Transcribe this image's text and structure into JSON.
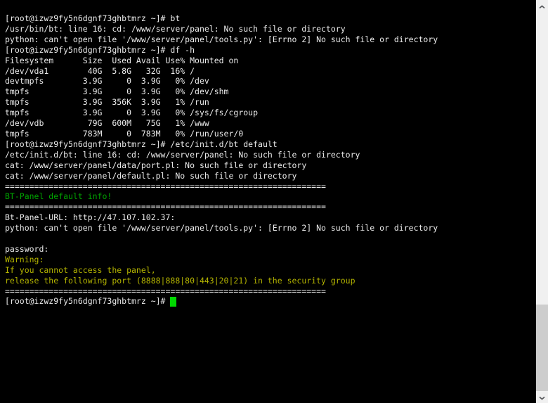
{
  "terminal": {
    "colors": {
      "background": "#000000",
      "foreground": "#ebebeb",
      "green": "#00a400",
      "yellow": "#b4b400",
      "cursor_green": "#00d800"
    },
    "lines": [
      {
        "text": "[root@izwz9fy5n6dgnf73ghbtmrz ~]# bt",
        "color": "default"
      },
      {
        "text": "/usr/bin/bt: line 16: cd: /www/server/panel: No such file or directory",
        "color": "default"
      },
      {
        "text": "python: can't open file '/www/server/panel/tools.py': [Errno 2] No such file or directory",
        "color": "default"
      },
      {
        "text": "[root@izwz9fy5n6dgnf73ghbtmrz ~]# df -h",
        "color": "default"
      },
      {
        "text": "Filesystem      Size  Used Avail Use% Mounted on",
        "color": "default"
      },
      {
        "text": "/dev/vda1        40G  5.8G   32G  16% /",
        "color": "default"
      },
      {
        "text": "devtmpfs        3.9G     0  3.9G   0% /dev",
        "color": "default"
      },
      {
        "text": "tmpfs           3.9G     0  3.9G   0% /dev/shm",
        "color": "default"
      },
      {
        "text": "tmpfs           3.9G  356K  3.9G   1% /run",
        "color": "default"
      },
      {
        "text": "tmpfs           3.9G     0  3.9G   0% /sys/fs/cgroup",
        "color": "default"
      },
      {
        "text": "/dev/vdb         79G  600M   75G   1% /www",
        "color": "default"
      },
      {
        "text": "tmpfs           783M     0  783M   0% /run/user/0",
        "color": "default"
      },
      {
        "text": "[root@izwz9fy5n6dgnf73ghbtmrz ~]# /etc/init.d/bt default",
        "color": "default"
      },
      {
        "text": "/etc/init.d/bt: line 16: cd: /www/server/panel: No such file or directory",
        "color": "default"
      },
      {
        "text": "cat: /www/server/panel/data/port.pl: No such file or directory",
        "color": "default"
      },
      {
        "text": "cat: /www/server/panel/default.pl: No such file or directory",
        "color": "default"
      },
      {
        "text": "==================================================================",
        "color": "default"
      },
      {
        "text": "BT-Panel default info!",
        "color": "green"
      },
      {
        "text": "==================================================================",
        "color": "default"
      },
      {
        "text": "Bt-Panel-URL: http://47.107.102.37:",
        "color": "default"
      },
      {
        "text": "python: can't open file '/www/server/panel/tools.py': [Errno 2] No such file or directory",
        "color": "default"
      },
      {
        "text": "",
        "color": "default"
      },
      {
        "text": "password:",
        "color": "default"
      },
      {
        "text": "Warning:",
        "color": "yellow"
      },
      {
        "text": "If you cannot access the panel,",
        "color": "yellow"
      },
      {
        "text": "release the following port (8888|888|80|443|20|21) in the security group",
        "color": "yellow"
      },
      {
        "text": "==================================================================",
        "color": "default"
      },
      {
        "text": "[root@izwz9fy5n6dgnf73ghbtmrz ~]# ",
        "color": "default",
        "cursor": true
      }
    ]
  },
  "scrollbar": {
    "track_color": "#f0f0f0",
    "thumb_color": "#cdcdcd",
    "arrow_color": "#56585b",
    "up_icon": "chevron-up-icon",
    "down_icon": "chevron-down-icon"
  }
}
